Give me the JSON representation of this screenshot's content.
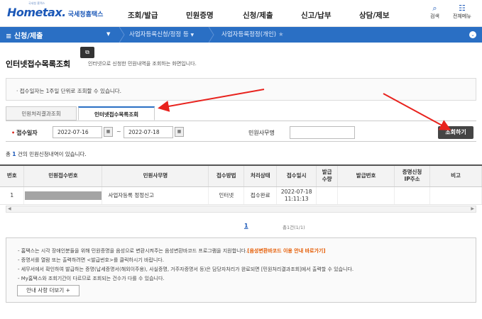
{
  "header": {
    "logo_text": "Hometax.",
    "logo_sub": "국세청홈택스",
    "logo_tiny": "국세청 홈택스",
    "menu": [
      "조회/발급",
      "민원증명",
      "신청/제출",
      "신고/납부",
      "상담/제보"
    ],
    "search_label": "검색",
    "allmenu_label": "전체메뉴"
  },
  "nav": {
    "menu_label": "≡  신청/제출",
    "crumb1": "사업자등록신청/정정 등",
    "crumb2": "사업자등록정정(개인)"
  },
  "page": {
    "title": "인터넷접수목록조회",
    "desc": "인터넷으로 신청한 민원내역을 조회하는 화면입니다.",
    "notice": "· 접수일자는 1주일 단위로 조회할 수 있습니다."
  },
  "tabs": [
    "민원처리결과조회",
    "인터넷접수목록조회"
  ],
  "search": {
    "date_label": "접수일자",
    "date_from": "2022-07-16",
    "date_to": "2022-07-18",
    "tilde": "~",
    "office_label": "민원사무명",
    "office_value": "",
    "button": "조회하기"
  },
  "count": {
    "prefix": "총 ",
    "num": "1",
    "suffix": " 건의 민원신청내역이 있습니다."
  },
  "table": {
    "headers": [
      "번호",
      "민원접수번호",
      "민원사무명",
      "접수방법",
      "처리상태",
      "접수일시",
      "발급\n수량",
      "발급번호",
      "증명신청\nIP주소",
      "비고"
    ],
    "rows": [
      {
        "no": "1",
        "receipt": "",
        "office": "사업자등록 정정신고",
        "method": "인터넷",
        "status": "접수완료",
        "date": "2022-07-18",
        "time": "11:11:13",
        "qty": "",
        "issue": "",
        "ip": "",
        "note": ""
      }
    ]
  },
  "pager": {
    "page": "1",
    "info": "총1건(1/1)"
  },
  "info": {
    "line1_a": "- 홈택스는 시각 장애인분들을 위해 민원증명을 음성으로 변환시켜주는 음성변환바코드 프로그램을 지원합니다.",
    "line1_link": "[음성변환바코드 이용 안내 바로가기]",
    "line2": "- 증명서를 열람 또는 출력하려면 <발급번호>를 클릭하시기 바랍니다.",
    "line3": "- 세무서에서 확인하여 발급하는 증명(납세증명서(해외이주용), 사실증명, 거주자증명서 등)은 담당자처리가 완료되면 [민원처리결과조회]에서 출력할 수 있습니다.",
    "line4": "- My홈택스와 조회기간이 다르므로 조회되는 건수가 다를 수 있습니다.",
    "more_button": "안내 사항 더보기 +"
  },
  "colors": {
    "accent": "#2a6fc4",
    "arrow": "#e8221d",
    "button": "#454545"
  }
}
